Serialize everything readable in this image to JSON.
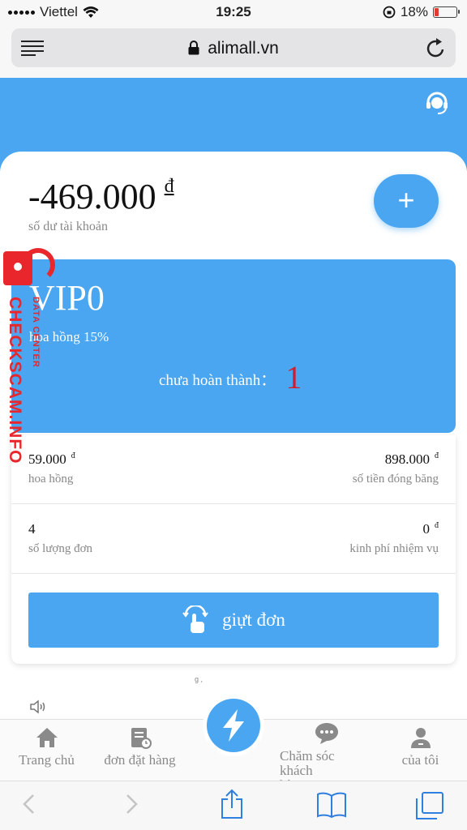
{
  "status_bar": {
    "carrier": "Viettel",
    "time": "19:25",
    "battery": "18%",
    "battery_level": 0.18
  },
  "browser": {
    "domain": "alimall.vn"
  },
  "account": {
    "balance": "-469.000",
    "currency_symbol": "đ",
    "balance_label": "số dư tài khoản"
  },
  "vip": {
    "level": "VIP0",
    "commission_rate": "hoa hồng 15%",
    "pending_label": "chưa hoàn thành：",
    "pending_count": "1"
  },
  "stats": {
    "commission_value": "59.000",
    "commission_label": "hoa hồng",
    "frozen_value": "898.000",
    "frozen_label": "số tiền đóng băng",
    "orders_value": "4",
    "orders_label": "số lượng đơn",
    "mission_value": "0",
    "mission_label": "kinh phí nhiệm vụ",
    "unit": "đ"
  },
  "grab_button_label": "giựt đơn",
  "faint_text": "g          ,",
  "watermark": {
    "main": "CHECKSCAM.INFO",
    "sub": "DATA CENTER"
  },
  "bottom_nav": {
    "home": "Trang chủ",
    "orders": "đơn đặt hàng",
    "support": "Chăm sóc khách hàng",
    "me": "của tôi"
  },
  "colors": {
    "accent": "#4aa6f0",
    "pending_count": "#d81b2c",
    "watermark": "#e8262b"
  }
}
